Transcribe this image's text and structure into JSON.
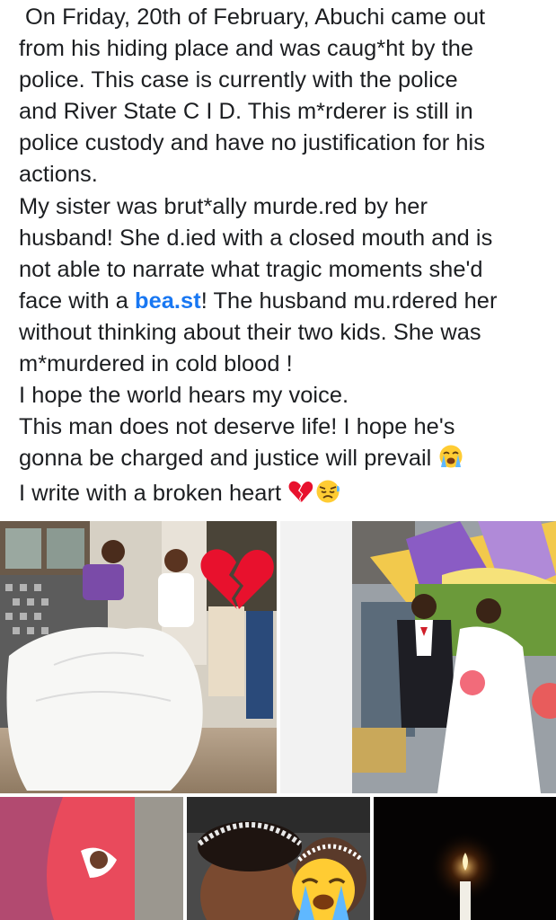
{
  "post": {
    "lines": [
      "On Friday, 20th of February, Abuchi came out",
      "from his hiding place and was caug*ht by the",
      "police. This case is currently with the police",
      "and River State C I D. This m*rderer is still in",
      "police custody and have no justification for his",
      "actions.",
      "My sister was brut*ally murde.red by her",
      "husband! She d.ied with a closed mouth and is",
      "not able to narrate what tragic moments she'd"
    ],
    "line_before_link": "face with a ",
    "link_text": "bea.st",
    "line_after_link": "! The husband mu.rdered her",
    "lines_after": [
      "without thinking about their two kids. She was",
      "m*murdered in cold blood !",
      "I hope the world hears my voice.",
      "This man does not deserve life! I hope he's"
    ],
    "line_justice": "gonna be charged and justice will prevail ",
    "line_heart": "I write with a broken heart ",
    "emojis": {
      "justice_line": "loudly-crying-face",
      "heart_line_1": "broken-heart",
      "heart_line_2": "disappointed-face",
      "photo_overlay_broken_heart": "broken-heart",
      "photo_overlay_crying": "loudly-crying-face"
    }
  },
  "photos": [
    {
      "name": "groom-carrying-bride-photo"
    },
    {
      "name": "couple-under-canopy-photo"
    },
    {
      "name": "couple-hands-photo"
    },
    {
      "name": "bride-selfie-photo"
    },
    {
      "name": "candle-in-dark-photo"
    }
  ],
  "colors": {
    "text": "#1c1e21",
    "link": "#1877f2",
    "broken_heart": "#e8112d"
  }
}
